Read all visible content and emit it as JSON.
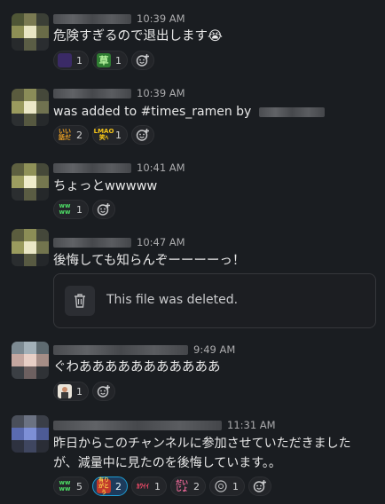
{
  "messages": [
    {
      "time": "10:39 AM",
      "text": "危険すぎるので退出します😭",
      "reactions": [
        {
          "emoji": "purple-blob-emoji",
          "count": "1"
        },
        {
          "emoji": "kusa-emoji",
          "label": "草",
          "count": "1"
        }
      ]
    },
    {
      "time": "10:39 AM",
      "text": "was added to #times_ramen by",
      "reactions": [
        {
          "emoji": "iitaberu-emoji",
          "label": "いい 話だ",
          "count": "2"
        },
        {
          "emoji": "lmao-emoji",
          "label": "LMAO 笑ﾍ",
          "count": "1"
        }
      ]
    },
    {
      "time": "10:41 AM",
      "text": "ちょっとwwwww",
      "reactions": [
        {
          "emoji": "www-emoji",
          "label": "ww ww",
          "count": "1"
        }
      ]
    },
    {
      "time": "10:47 AM",
      "text": "後悔しても知らんぞーーーーっ！",
      "file_deleted": "This file was deleted."
    },
    {
      "time": "9:49 AM",
      "text": "ぐわあああああああああああ",
      "reactions": [
        {
          "emoji": "person-photo-emoji",
          "count": "1"
        }
      ]
    },
    {
      "time": "11:31 AM",
      "text_line1": "昨日からこのチャンネルに参加させていただきました",
      "text_line2": "が、減量中に見たのを後悔しています。。",
      "reactions": [
        {
          "emoji": "www-emoji",
          "label": "ww ww",
          "count": "5"
        },
        {
          "emoji": "arigatou-emoji",
          "label": "有りがとう",
          "count": "2",
          "active": true
        },
        {
          "emoji": "kawaii-emoji",
          "label": "ｶﾜｲｲ",
          "count": "1"
        },
        {
          "emoji": "daijoubu-emoji",
          "label": "だい じょ",
          "count": "2"
        },
        {
          "emoji": "face-emoji",
          "count": "1"
        }
      ]
    }
  ],
  "colors": {
    "background": "#1a1d21",
    "active_reaction": "#1d9bd1"
  }
}
